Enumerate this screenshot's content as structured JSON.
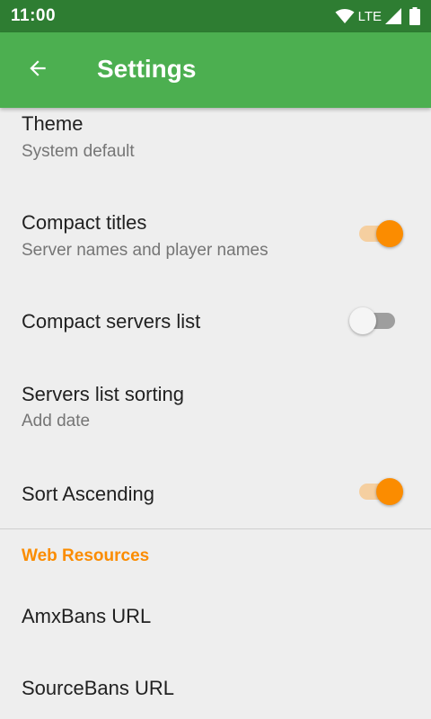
{
  "status_bar": {
    "time": "11:00",
    "network": "LTE",
    "icons": [
      "wifi-icon",
      "cellular-signal-icon",
      "battery-icon"
    ]
  },
  "app_bar": {
    "title": "Settings",
    "back_icon": "arrow-left-icon",
    "color": "#4caf50"
  },
  "preferences": [
    {
      "title": "Theme",
      "summary": "System default"
    },
    {
      "title": "Compact titles",
      "summary": "Server names and player names",
      "switch_on": true
    },
    {
      "title": "Compact servers list",
      "switch_on": false
    },
    {
      "title": "Servers list sorting",
      "summary": "Add date"
    },
    {
      "title": "Sort Ascending",
      "switch_on": true
    }
  ],
  "category": {
    "title": "Web Resources",
    "color": "#fb8c00"
  },
  "web_resources": [
    {
      "title": "AmxBans URL"
    },
    {
      "title": "SourceBans URL"
    }
  ],
  "colors": {
    "accent": "#fb8c00",
    "status_bar": "#2e7d32",
    "background": "#eeeeee"
  }
}
